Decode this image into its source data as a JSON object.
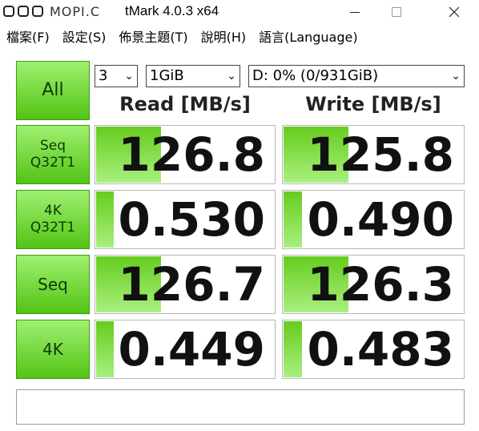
{
  "titlebar": {
    "watermark_text": "MOPI.C",
    "title": "tMark 4.0.3 x64"
  },
  "menu": [
    {
      "label": "檔案(F)"
    },
    {
      "label": "設定(S)"
    },
    {
      "label": "佈景主題(T)"
    },
    {
      "label": "說明(H)"
    },
    {
      "label": "語言(Language)"
    }
  ],
  "controls": {
    "all_button": "All",
    "count": "3",
    "size": "1GiB",
    "drive": "D: 0% (0/931GiB)"
  },
  "headers": {
    "read": "Read [MB/s]",
    "write": "Write [MB/s]"
  },
  "tests": [
    {
      "label": "Seq\nQ32T1",
      "read": "126.8",
      "write": "125.8",
      "read_fill": 0.36,
      "write_fill": 0.36
    },
    {
      "label": "4K\nQ32T1",
      "read": "0.530",
      "write": "0.490",
      "read_fill": 0.1,
      "write_fill": 0.1
    },
    {
      "label": "Seq",
      "read": "126.7",
      "write": "126.3",
      "read_fill": 0.36,
      "write_fill": 0.36
    },
    {
      "label": "4K",
      "read": "0.449",
      "write": "0.483",
      "read_fill": 0.1,
      "write_fill": 0.1
    }
  ],
  "comment": "",
  "colors": {
    "button_green_top": "#9ff070",
    "button_green_bottom": "#52c414",
    "bar_green": "#66cc1e"
  }
}
